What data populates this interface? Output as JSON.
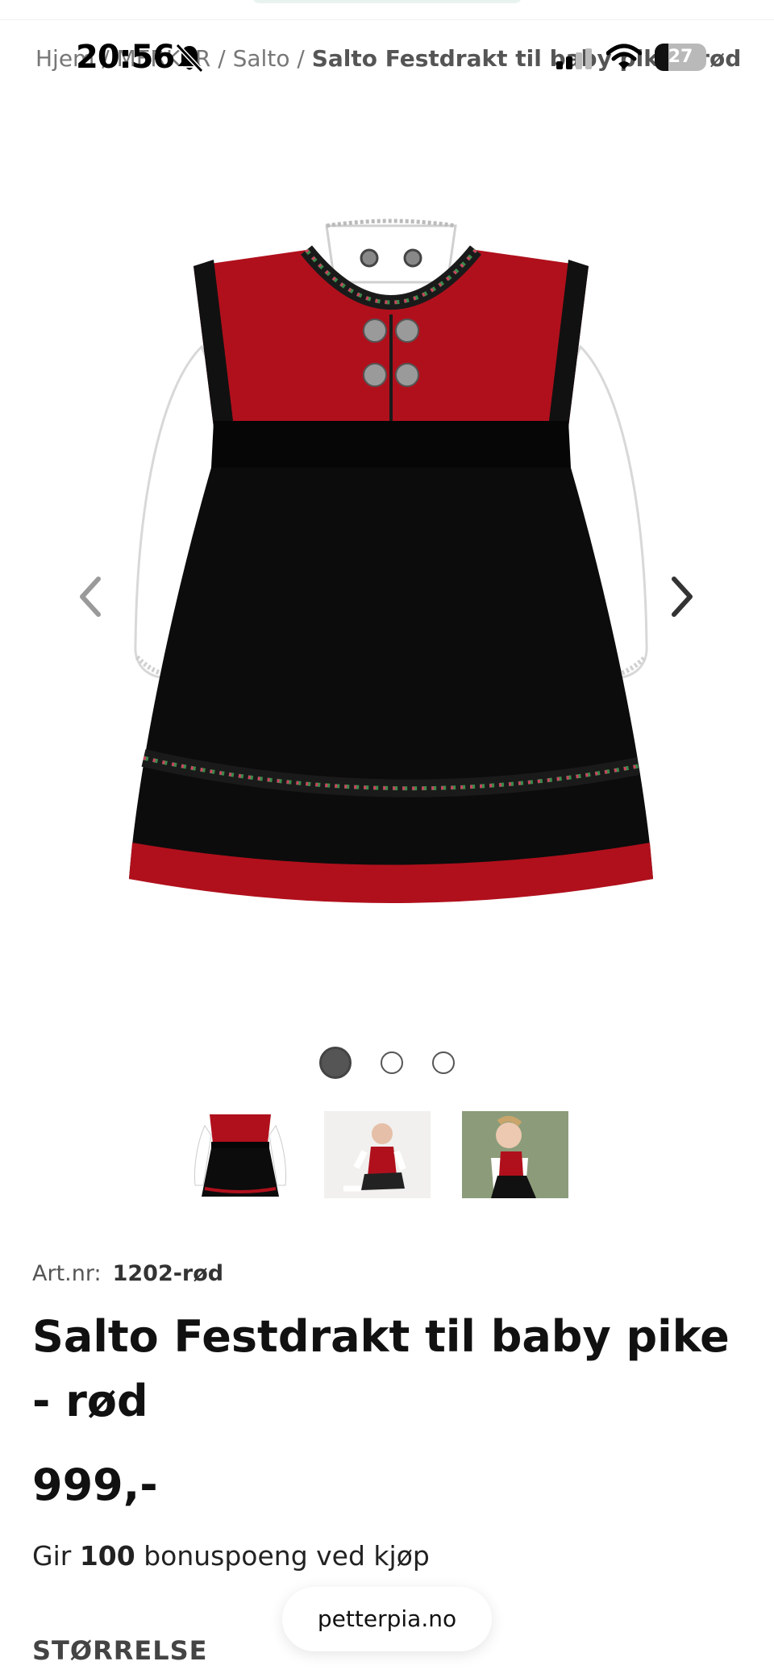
{
  "status_bar": {
    "time": "20:56",
    "battery_level": "27",
    "bell_icon": "bell-slash-icon",
    "signal_icon": "cellular-signal-icon",
    "wifi_icon": "wifi-icon"
  },
  "breadcrumb": {
    "home": "Hjem",
    "sep1": " / ",
    "category": "MERKER",
    "sep2": " / ",
    "brand": "Salto",
    "sep3": " / ",
    "current": "Salto Festdrakt til baby pike - rød"
  },
  "gallery": {
    "prev_icon": "chevron-left-icon",
    "next_icon": "chevron-right-icon",
    "slide_count": 3,
    "active_slide": 1
  },
  "product": {
    "artnr_label": "Art.nr:",
    "artnr_value": "1202-rød",
    "title": "Salto Festdrakt til baby pike - rød",
    "price": "999,-",
    "bonus_prefix": "Gir",
    "bonus_points": "100",
    "bonus_suffix": "bonuspoeng ved kjøp",
    "size_label": "STØRRELSE"
  },
  "browser": {
    "url": "petterpia.no"
  },
  "colors": {
    "dress_red": "#b0101c",
    "dress_black": "#0c0c0c",
    "blouse_white": "#ffffff",
    "text_dark": "#111111",
    "text_muted": "#777777"
  }
}
